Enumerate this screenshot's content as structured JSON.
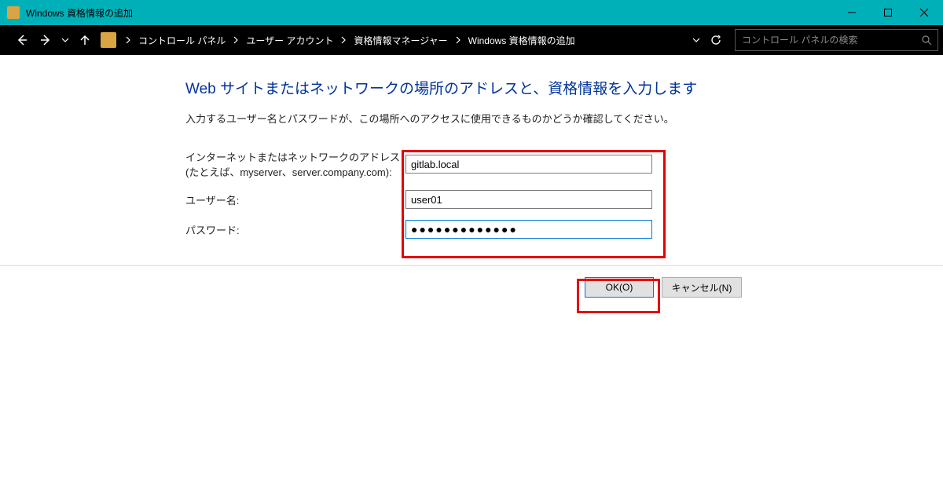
{
  "window": {
    "title": "Windows 資格情報の追加"
  },
  "breadcrumbs": {
    "items": [
      "コントロール パネル",
      "ユーザー アカウント",
      "資格情報マネージャー",
      "Windows 資格情報の追加"
    ]
  },
  "search": {
    "placeholder": "コントロール パネルの検索"
  },
  "content": {
    "heading": "Web サイトまたはネットワークの場所のアドレスと、資格情報を入力します",
    "description": "入力するユーザー名とパスワードが、この場所へのアクセスに使用できるものかどうか確認してください。",
    "labels": {
      "address": "インターネットまたはネットワークのアドレス",
      "address_hint": "(たとえば、myserver、server.company.com):",
      "username": "ユーザー名:",
      "password": "パスワード:"
    },
    "values": {
      "address": "gitlab.local",
      "username": "user01",
      "password_masked": "●●●●●●●●●●●●●"
    }
  },
  "buttons": {
    "ok": "OK(O)",
    "cancel": "キャンセル(N)"
  }
}
